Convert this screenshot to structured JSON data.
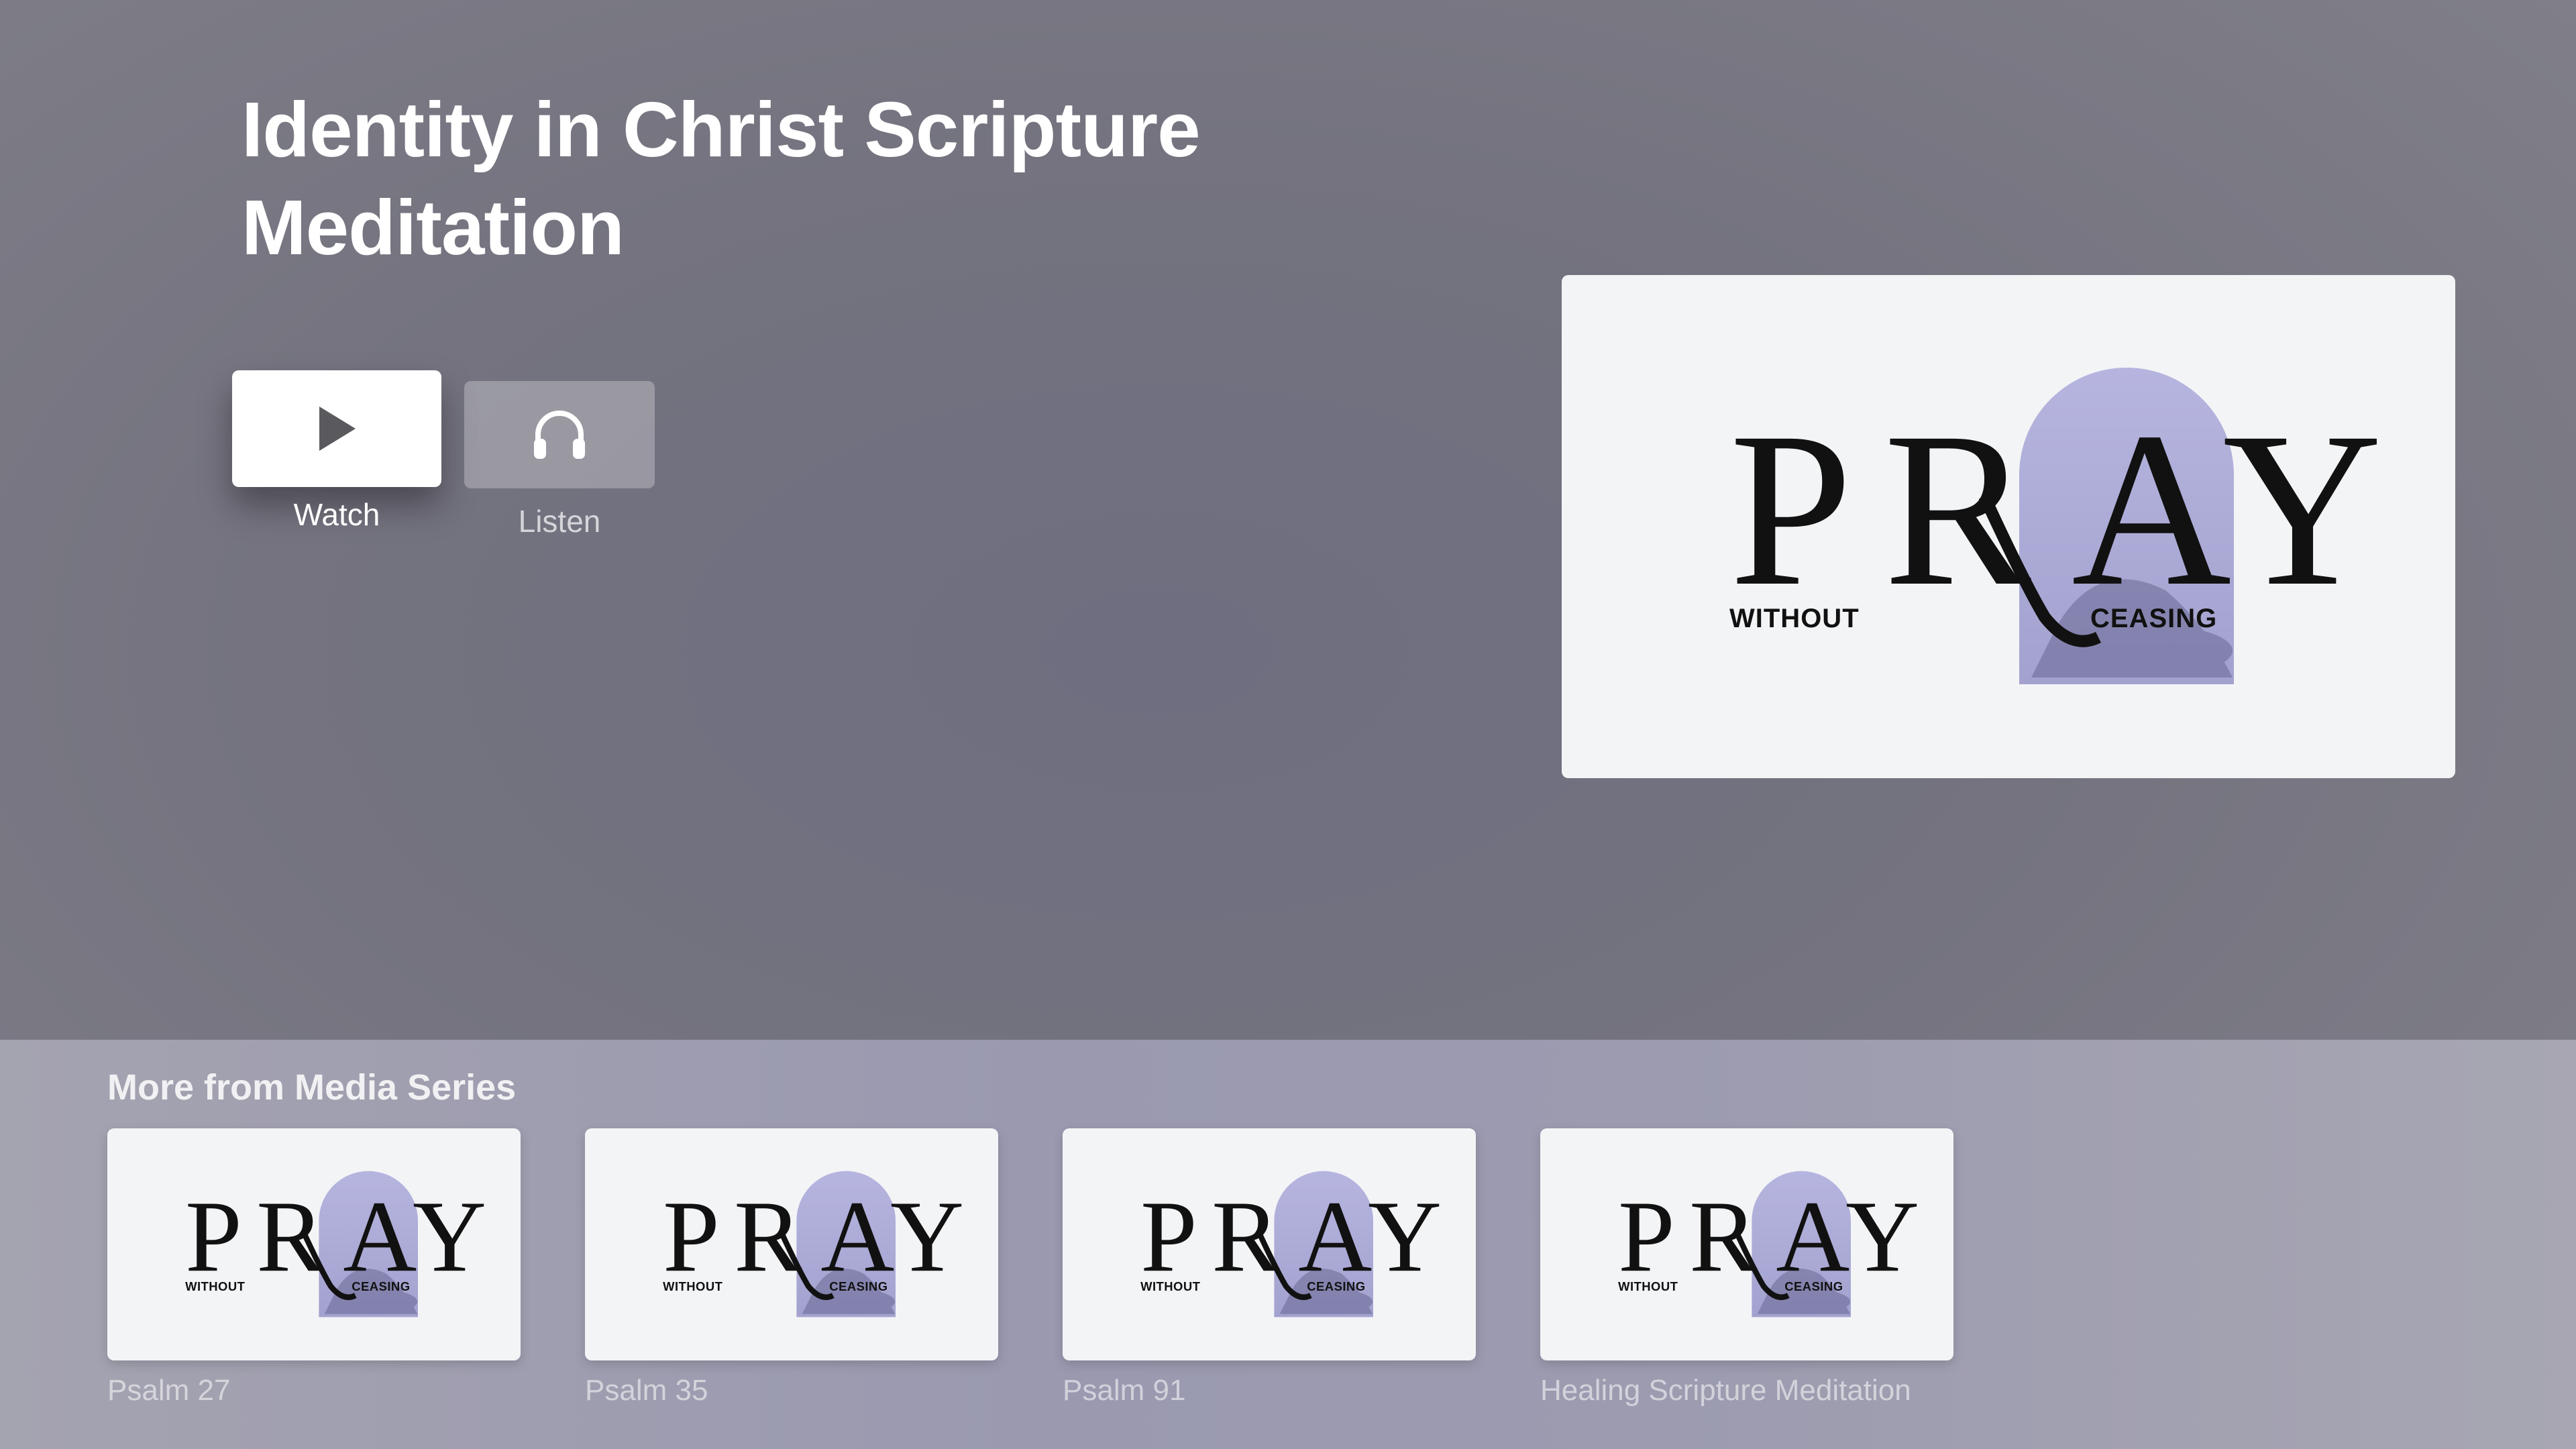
{
  "hero": {
    "title": "Identity in Christ Scripture Meditation",
    "actions": {
      "watch_label": "Watch",
      "listen_label": "Listen"
    },
    "artwork": {
      "logo_main": "PRAY",
      "logo_left": "WITHOUT",
      "logo_right": "CEASING"
    }
  },
  "shelf": {
    "title": "More from Media Series",
    "items": [
      {
        "caption": "Psalm 27"
      },
      {
        "caption": "Psalm 35"
      },
      {
        "caption": "Psalm 91"
      },
      {
        "caption": "Healing Scripture Meditation"
      }
    ]
  },
  "colors": {
    "logo_arch": "#b0afd8",
    "logo_text": "#111111",
    "artwork_bg": "#f3f4f6"
  },
  "icons": {
    "watch": "play-icon",
    "listen": "headphones-icon"
  }
}
